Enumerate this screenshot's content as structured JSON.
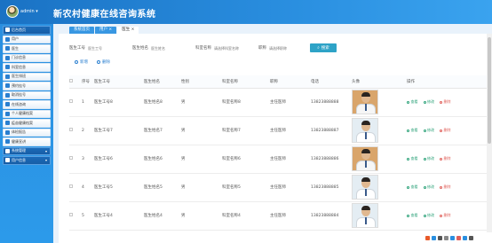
{
  "header": {
    "user": "admin",
    "title": "新农村健康在线咨询系统"
  },
  "sidebar": {
    "items": [
      {
        "label": "后台首页",
        "dark": true
      },
      {
        "label": "用户",
        "dark": false
      },
      {
        "label": "医生",
        "dark": false
      },
      {
        "label": "门诊信息",
        "dark": false
      },
      {
        "label": "科室信息",
        "dark": false
      },
      {
        "label": "医生排班",
        "dark": false
      },
      {
        "label": "预约挂号",
        "dark": false
      },
      {
        "label": "取消挂号",
        "dark": false
      },
      {
        "label": "在线咨询",
        "dark": false
      },
      {
        "label": "个人健康档案",
        "dark": false
      },
      {
        "label": "疫苗健康档案",
        "dark": false
      },
      {
        "label": "体检报告",
        "dark": false
      },
      {
        "label": "健康宣讲",
        "dark": false
      },
      {
        "label": "系统管理",
        "dark": true
      },
      {
        "label": "用户信息",
        "dark": true
      }
    ]
  },
  "tabs": [
    {
      "label": "系统首页",
      "active": false
    },
    {
      "label": "用户 ×",
      "active": false
    },
    {
      "label": "医生 ×",
      "active": true
    }
  ],
  "search": {
    "doctor_id_label": "医生工号",
    "doctor_id_placeholder": "医生工号",
    "doctor_name_label": "医生姓名",
    "doctor_name_placeholder": "医生姓名",
    "dept_label": "科室名称",
    "dept_placeholder": "请选择科室名称",
    "title_label": "职称",
    "title_placeholder": "请选择职称",
    "button": "搜索"
  },
  "actions": {
    "add": "新增",
    "delete": "删除"
  },
  "table": {
    "columns": [
      "序号",
      "医生工号",
      "医生姓名",
      "性别",
      "科室名称",
      "职称",
      "电话",
      "头像",
      "操作"
    ],
    "rows": [
      {
        "no": "1",
        "id": "医生工号8",
        "name": "医生姓名8",
        "gender": "男",
        "dept": "科室名称8",
        "title": "主任医师",
        "phone": "13823888888",
        "photo": "warm"
      },
      {
        "no": "2",
        "id": "医生工号7",
        "name": "医生姓名7",
        "gender": "男",
        "dept": "科室名称7",
        "title": "主任医师",
        "phone": "13823888887",
        "photo": "cool"
      },
      {
        "no": "3",
        "id": "医生工号6",
        "name": "医生姓名6",
        "gender": "男",
        "dept": "科室名称6",
        "title": "主任医师",
        "phone": "13823888886",
        "photo": "warm"
      },
      {
        "no": "4",
        "id": "医生工号5",
        "name": "医生姓名5",
        "gender": "男",
        "dept": "科室名称5",
        "title": "主任医师",
        "phone": "13823888885",
        "photo": "cool"
      },
      {
        "no": "5",
        "id": "医生工号4",
        "name": "医生姓名4",
        "gender": "男",
        "dept": "科室名称4",
        "title": "主任医师",
        "phone": "13823888884",
        "photo": "cool"
      }
    ],
    "ops": {
      "view": "查看",
      "edit": "修改",
      "delete": "删除"
    }
  }
}
